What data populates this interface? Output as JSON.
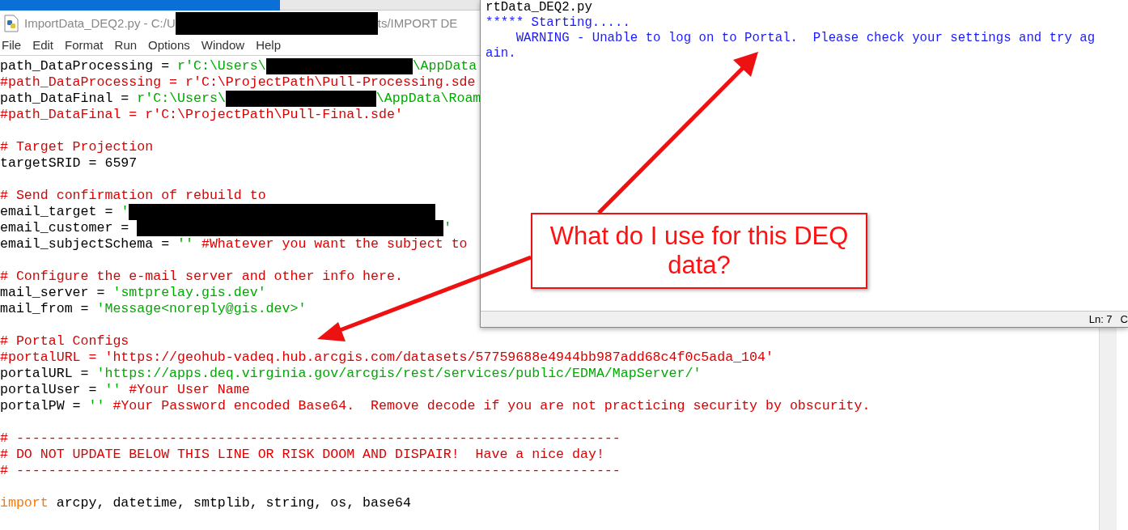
{
  "editor": {
    "title": "ImportData_DEQ2.py - C:/U",
    "title_end": "ts/IMPORT DE",
    "menu": [
      "File",
      "Edit",
      "Format",
      "Run",
      "Options",
      "Window",
      "Help"
    ],
    "lines": [
      {
        "kind": "code",
        "segments": [
          {
            "kind": "plain",
            "text": "path_DataProcessing = "
          },
          {
            "kind": "string",
            "text": "r'C:\\Users\\"
          },
          {
            "kind": "redacted"
          },
          {
            "kind": "string",
            "text": "\\AppData"
          }
        ]
      },
      {
        "kind": "code",
        "segments": [
          {
            "kind": "comment",
            "text": "#path_DataProcessing = r'C:\\ProjectPath\\Pull-Processing.sde"
          }
        ]
      },
      {
        "kind": "code",
        "segments": [
          {
            "kind": "plain",
            "text": "path_DataFinal = "
          },
          {
            "kind": "string",
            "text": "r'C:\\Users\\"
          },
          {
            "kind": "redacted"
          },
          {
            "kind": "string",
            "text": "\\AppData\\Roam"
          }
        ]
      },
      {
        "kind": "code",
        "segments": [
          {
            "kind": "comment",
            "text": "#path_DataFinal = r'C:\\ProjectPath\\Pull-Final.sde'"
          }
        ]
      },
      {
        "kind": "blank"
      },
      {
        "kind": "code",
        "segments": [
          {
            "kind": "comment",
            "text": "# Target Projection"
          }
        ]
      },
      {
        "kind": "code",
        "segments": [
          {
            "kind": "plain",
            "text": "targetSRID = 6597"
          }
        ]
      },
      {
        "kind": "blank"
      },
      {
        "kind": "code",
        "segments": [
          {
            "kind": "comment",
            "text": "# Send confirmation of rebuild to"
          }
        ]
      },
      {
        "kind": "code",
        "segments": [
          {
            "kind": "plain",
            "text": "email_target = "
          },
          {
            "kind": "string",
            "text": "'"
          },
          {
            "kind": "redacted"
          }
        ]
      },
      {
        "kind": "code",
        "segments": [
          {
            "kind": "plain",
            "text": "email_customer = "
          },
          {
            "kind": "redacted"
          },
          {
            "kind": "string",
            "text": "'"
          }
        ]
      },
      {
        "kind": "code",
        "segments": [
          {
            "kind": "plain",
            "text": "email_subjectSchema = "
          },
          {
            "kind": "string",
            "text": "''"
          },
          {
            "kind": "comment",
            "text": " #Whatever you want the subject to"
          }
        ]
      },
      {
        "kind": "blank"
      },
      {
        "kind": "code",
        "segments": [
          {
            "kind": "comment",
            "text": "# Configure the e-mail server and other info here."
          }
        ]
      },
      {
        "kind": "code",
        "segments": [
          {
            "kind": "plain",
            "text": "mail_server = "
          },
          {
            "kind": "string",
            "text": "'smtprelay.gis.dev'"
          }
        ]
      },
      {
        "kind": "code",
        "segments": [
          {
            "kind": "plain",
            "text": "mail_from = "
          },
          {
            "kind": "string",
            "text": "'Message<noreply@gis.dev>'"
          }
        ]
      },
      {
        "kind": "blank"
      },
      {
        "kind": "code",
        "segments": [
          {
            "kind": "comment",
            "text": "# Portal Configs"
          }
        ]
      },
      {
        "kind": "code",
        "segments": [
          {
            "kind": "comment",
            "text": "#portalURL = 'https://geohub-vadeq.hub.arcgis.com/datasets/57759688e4944bb987add68c4f0c5ada_104'"
          }
        ]
      },
      {
        "kind": "code",
        "segments": [
          {
            "kind": "plain",
            "text": "portalURL = "
          },
          {
            "kind": "string",
            "text": "'https://apps.deq.virginia.gov/arcgis/rest/services/public/EDMA/MapServer/'"
          }
        ]
      },
      {
        "kind": "code",
        "segments": [
          {
            "kind": "plain",
            "text": "portalUser = "
          },
          {
            "kind": "string",
            "text": "''"
          },
          {
            "kind": "comment",
            "text": " #Your User Name"
          }
        ]
      },
      {
        "kind": "code",
        "segments": [
          {
            "kind": "plain",
            "text": "portalPW = "
          },
          {
            "kind": "string",
            "text": "''"
          },
          {
            "kind": "comment",
            "text": " #Your Password encoded Base64.  Remove decode if you are not practicing security by obscurity."
          }
        ]
      },
      {
        "kind": "blank"
      },
      {
        "kind": "code",
        "segments": [
          {
            "kind": "comment",
            "text": "# ---------------------------------------------------------------------------"
          }
        ]
      },
      {
        "kind": "code",
        "segments": [
          {
            "kind": "comment",
            "text": "# DO NOT UPDATE BELOW THIS LINE OR RISK DOOM AND DISPAIR!  Have a nice day!"
          }
        ]
      },
      {
        "kind": "code",
        "segments": [
          {
            "kind": "comment",
            "text": "# ---------------------------------------------------------------------------"
          }
        ]
      },
      {
        "kind": "blank"
      },
      {
        "kind": "code",
        "segments": [
          {
            "kind": "keyword",
            "text": "import"
          },
          {
            "kind": "plain",
            "text": " arcpy, datetime, smtplib, string, os, base64"
          }
        ]
      }
    ]
  },
  "shell": {
    "lines": [
      {
        "kind": "plain",
        "text": "rtData_DEQ2.py"
      },
      {
        "kind": "output",
        "text": "***** Starting....."
      },
      {
        "kind": "output",
        "text": "    WARNING - Unable to log on to Portal.  Please check your settings and try ag"
      },
      {
        "kind": "output",
        "text": "ain."
      }
    ],
    "status": [
      "Ln: 7",
      "C"
    ]
  },
  "callout": {
    "text": "What do I use for this DEQ data?"
  }
}
